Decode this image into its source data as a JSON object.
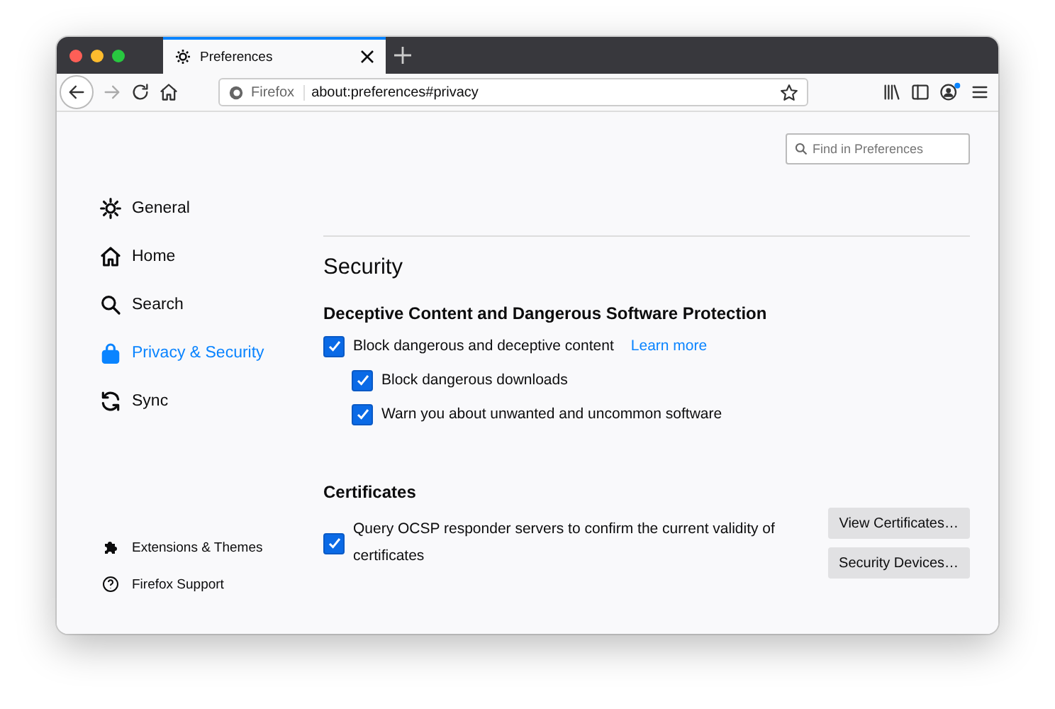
{
  "tabs": [
    {
      "title": "Preferences",
      "selected": true
    }
  ],
  "address_bar": {
    "identity": "Firefox",
    "url": "about:preferences#privacy"
  },
  "search": {
    "placeholder": "Find in Preferences"
  },
  "sidebar": {
    "items": [
      {
        "label": "General",
        "selected": false
      },
      {
        "label": "Home",
        "selected": false
      },
      {
        "label": "Search",
        "selected": false
      },
      {
        "label": "Privacy & Security",
        "selected": true
      },
      {
        "label": "Sync",
        "selected": false
      }
    ],
    "footer": [
      {
        "label": "Extensions & Themes"
      },
      {
        "label": "Firefox Support"
      }
    ]
  },
  "page": {
    "title": "Security",
    "deceptive": {
      "heading": "Deceptive Content and Dangerous Software Protection",
      "options": [
        {
          "label": "Block dangerous and deceptive content",
          "link": "Learn more",
          "checked": true,
          "children": [
            {
              "label": "Block dangerous downloads",
              "checked": true
            },
            {
              "label": "Warn you about unwanted and uncommon software",
              "checked": true
            }
          ]
        }
      ]
    },
    "certificates": {
      "heading": "Certificates",
      "option": {
        "label": "Query OCSP responder servers to confirm the current validity of certificates",
        "checked": true
      },
      "buttons": [
        "View Certificates…",
        "Security Devices…"
      ]
    }
  }
}
